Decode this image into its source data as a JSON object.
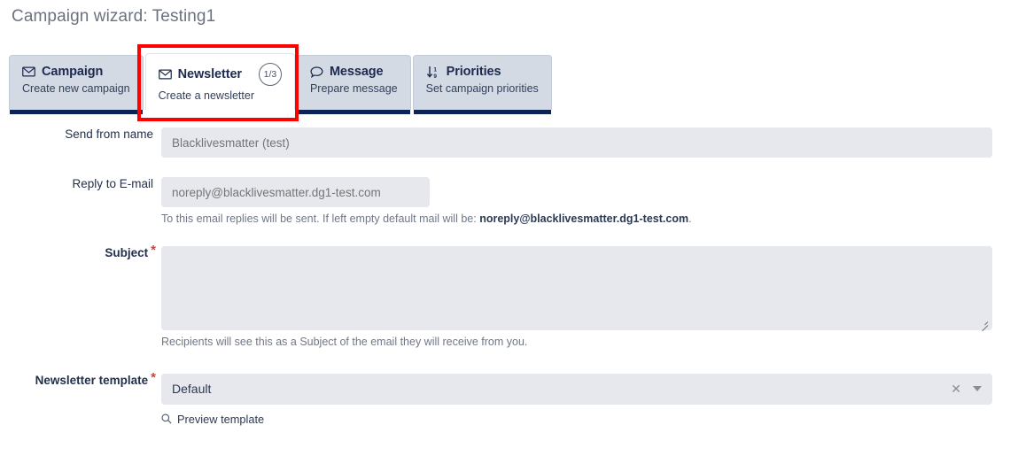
{
  "page": {
    "title": "Campaign wizard: Testing1"
  },
  "tabs": [
    {
      "title": "Campaign",
      "subtitle": "Create new campaign",
      "icon": "envelope-icon",
      "badge": "",
      "active": false
    },
    {
      "title": "Newsletter",
      "subtitle": "Create a newsletter",
      "icon": "envelope-icon",
      "badge": "1/3",
      "active": true
    },
    {
      "title": "Message",
      "subtitle": "Prepare message",
      "icon": "speech-bubble-icon",
      "badge": "",
      "active": false
    },
    {
      "title": "Priorities",
      "subtitle": "Set campaign priorities",
      "icon": "sort-numeric-down-icon",
      "badge": "",
      "active": false
    }
  ],
  "highlight": {
    "color": "#fe0000"
  },
  "form": {
    "send_from_name": {
      "label": "Send from name",
      "value": "",
      "placeholder": "Blacklivesmatter (test)"
    },
    "reply_to_email": {
      "label": "Reply to E-mail",
      "value": "",
      "placeholder": "noreply@blacklivesmatter.dg1-test.com",
      "help_prefix": "To this email replies will be sent. If left empty default mail will be: ",
      "help_strong": "noreply@blacklivesmatter.dg1-test.com",
      "help_suffix": "."
    },
    "subject": {
      "label": "Subject",
      "required_marker": "*",
      "value": "",
      "placeholder": "",
      "help": "Recipients will see this as a Subject of the email they will receive from you."
    },
    "newsletter_template": {
      "label": "Newsletter template",
      "required_marker": "*",
      "value": "Default",
      "clear_glyph": "✕",
      "preview_link": "Preview template"
    }
  }
}
